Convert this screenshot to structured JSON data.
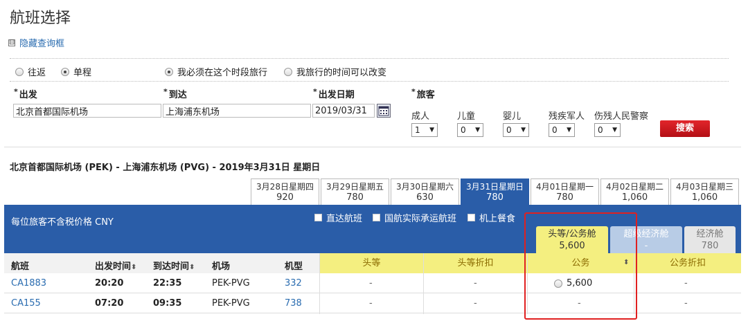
{
  "page": {
    "title": "航班选择",
    "hide_search": "隐藏查询框",
    "collapse_glyph": "⊟"
  },
  "trip_type": [
    {
      "label": "往返",
      "selected": false
    },
    {
      "label": "单程",
      "selected": true
    }
  ],
  "time_mode": [
    {
      "label": "我必须在这个时段旅行",
      "selected": true
    },
    {
      "label": "我旅行的时间可以改变",
      "selected": false
    }
  ],
  "form": {
    "required_mark": "*",
    "origin_label": "出发",
    "origin_value": "北京首都国际机场",
    "destination_label": "到达",
    "destination_value": "上海浦东机场",
    "date_label": "出发日期",
    "date_value": "2019/03/31",
    "passengers_label": "旅客",
    "passengers": [
      {
        "label": "成人",
        "value": "1"
      },
      {
        "label": "儿童",
        "value": "0"
      },
      {
        "label": "婴儿",
        "value": "0"
      },
      {
        "label": "残疾军人",
        "value": "0"
      },
      {
        "label": "伤残人民警察",
        "value": "0"
      }
    ],
    "dropdown_glyph": "▼",
    "search_button": "搜索"
  },
  "route_summary": "北京首都国际机场 (PEK) - 上海浦东机场 (PVG) - 2019年3月31日 星期日",
  "date_tabs": [
    {
      "label": "3月28日星期四",
      "price": "920",
      "active": false
    },
    {
      "label": "3月29日星期五",
      "price": "780",
      "active": false
    },
    {
      "label": "3月30日星期六",
      "price": "630",
      "active": false
    },
    {
      "label": "3月31日星期日",
      "price": "780",
      "active": true
    },
    {
      "label": "4月01日星期一",
      "price": "780",
      "active": false
    },
    {
      "label": "4月02日星期二",
      "price": "1,060",
      "active": false
    },
    {
      "label": "4月03日星期三",
      "price": "1,060",
      "active": false
    }
  ],
  "results": {
    "price_note": "每位旅客不含税价格 CNY",
    "filters": [
      "直达航班",
      "国航实际承运航班",
      "机上餐食"
    ],
    "cabins": [
      {
        "label": "头等/公务舱",
        "price": "5,600",
        "active": true
      },
      {
        "label": "超级经济舱",
        "price": "-",
        "active": false
      },
      {
        "label": "经济舱",
        "price": "780",
        "active": false
      }
    ],
    "columns": {
      "flight": "航班",
      "depart": "出发时间",
      "arrive": "到达时间",
      "airport": "机场",
      "aircraft": "机型"
    },
    "fare_columns": [
      "头等",
      "头等折扣",
      "公务",
      "公务折扣"
    ],
    "sort_glyph": "⬍",
    "rows": [
      {
        "flight": "CA1883",
        "depart": "20:20",
        "arrive": "22:35",
        "airport": "PEK-PVG",
        "aircraft": "332",
        "fares": [
          "-",
          "-",
          "5,600",
          "-"
        ]
      },
      {
        "flight": "CA155",
        "depart": "07:20",
        "arrive": "09:35",
        "airport": "PEK-PVG",
        "aircraft": "738",
        "fares": [
          "-",
          "-",
          "-",
          "-"
        ]
      }
    ]
  },
  "colors": {
    "header_blue": "#2a5da8",
    "fare_yellow": "#f4ef80",
    "highlight_red": "#e02020",
    "search_red": "#d41b22"
  }
}
